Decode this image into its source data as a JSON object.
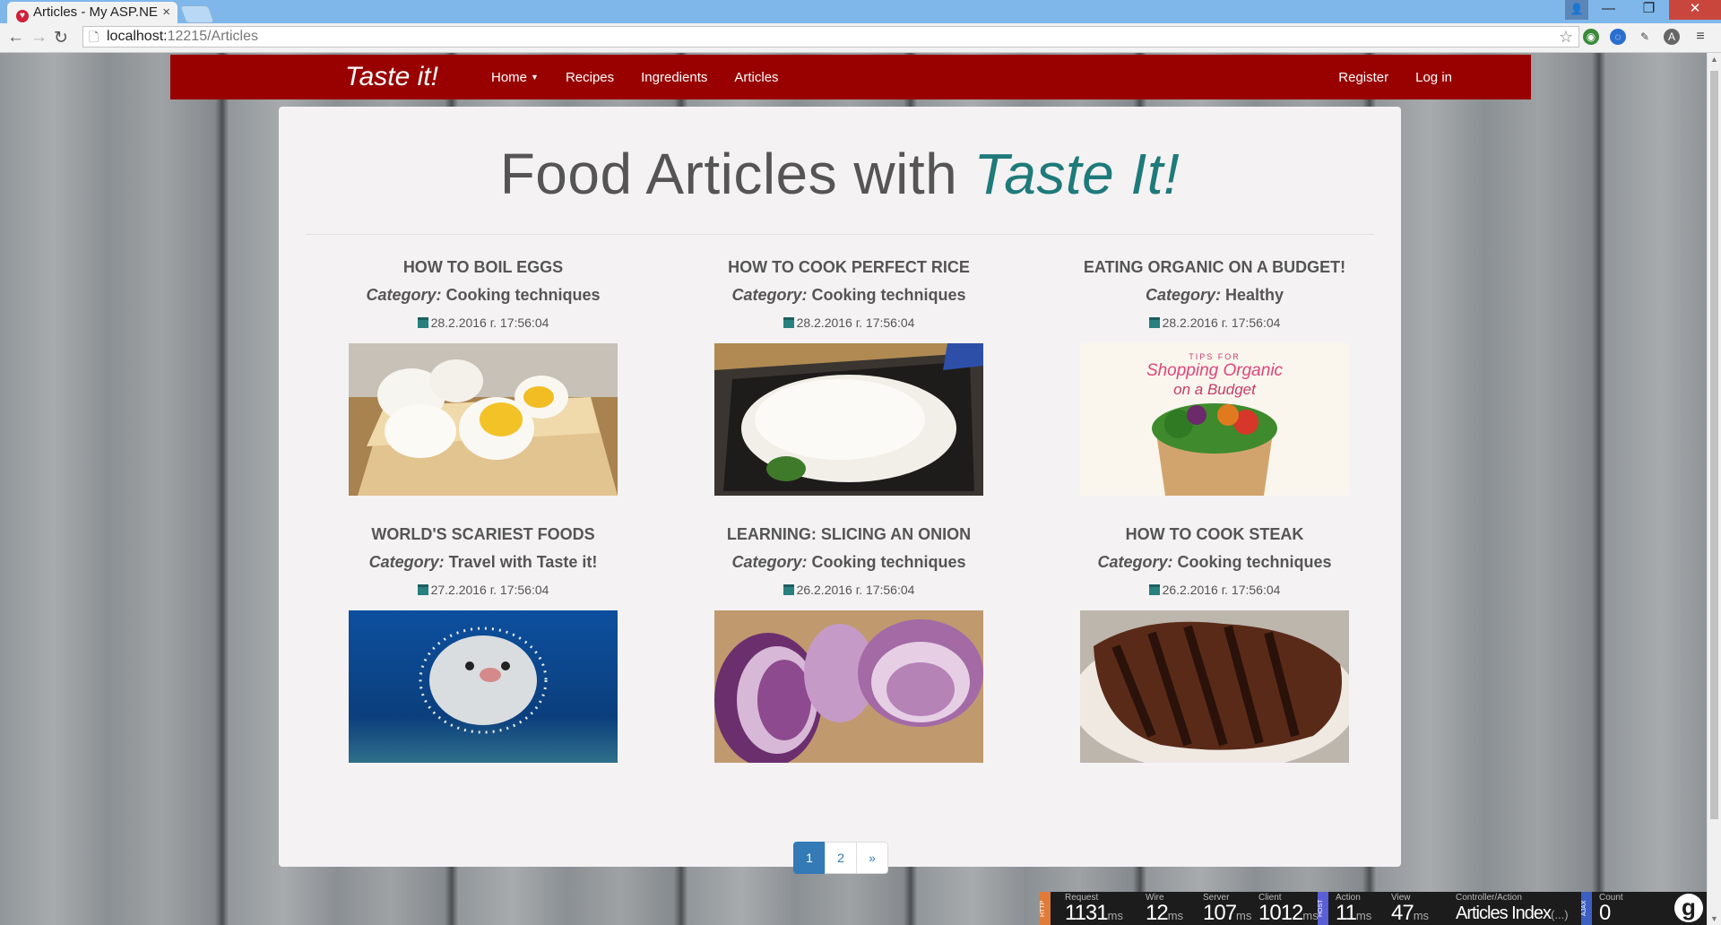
{
  "browser": {
    "tab_title": "Articles - My ASP.NE",
    "url_host": "localhost:",
    "url_path": "12215/Articles"
  },
  "navbar": {
    "brand": "Taste it!",
    "links": [
      "Home",
      "Recipes",
      "Ingredients",
      "Articles"
    ],
    "right_links": [
      "Register",
      "Log in"
    ]
  },
  "page": {
    "title_main": "Food Articles with ",
    "title_accent": "Taste It!",
    "category_label": "Category:"
  },
  "articles": [
    {
      "title": "HOW TO BOIL EGGS",
      "category": "Cooking techniques",
      "date": "28.2.2016 г. 17:56:04"
    },
    {
      "title": "HOW TO COOK PERFECT RICE",
      "category": "Cooking techniques",
      "date": "28.2.2016 г. 17:56:04"
    },
    {
      "title": "EATING ORGANIC ON A BUDGET!",
      "category": "Healthy",
      "date": "28.2.2016 г. 17:56:04"
    },
    {
      "title": "WORLD'S SCARIEST FOODS",
      "category": "Travel with Taste it!",
      "date": "27.2.2016 г. 17:56:04"
    },
    {
      "title": "LEARNING: SLICING AN ONION",
      "category": "Cooking techniques",
      "date": "26.2.2016 г. 17:56:04"
    },
    {
      "title": "HOW TO COOK STEAK",
      "category": "Cooking techniques",
      "date": "26.2.2016 г. 17:56:04"
    }
  ],
  "organic_image_text": {
    "top": "TIPS FOR",
    "line1": "Shopping Organic",
    "line2": "on a Budget"
  },
  "pager": {
    "pages": [
      "1",
      "2"
    ],
    "next": "»",
    "current": "1"
  },
  "glimpse": {
    "http_tag": "HTTP",
    "host_tag": "HOST",
    "ajax_tag": "AJAX",
    "request": {
      "label": "Request",
      "value": "1131",
      "unit": "ms"
    },
    "wire": {
      "label": "Wire",
      "value": "12",
      "unit": "ms"
    },
    "server": {
      "label": "Server",
      "value": "107",
      "unit": "ms"
    },
    "client": {
      "label": "Client",
      "value": "1012",
      "unit": "ms"
    },
    "action": {
      "label": "Action",
      "value": "11",
      "unit": "ms"
    },
    "view": {
      "label": "View",
      "value": "47",
      "unit": "ms"
    },
    "controller": {
      "label": "Controller/Action",
      "value": "Articles Index",
      "suffix": "(...)"
    },
    "count": {
      "label": "Count",
      "value": "0"
    }
  },
  "colors": {
    "navbar": "#990000",
    "accent": "#1f7a7a",
    "pager_active": "#337ab7"
  }
}
